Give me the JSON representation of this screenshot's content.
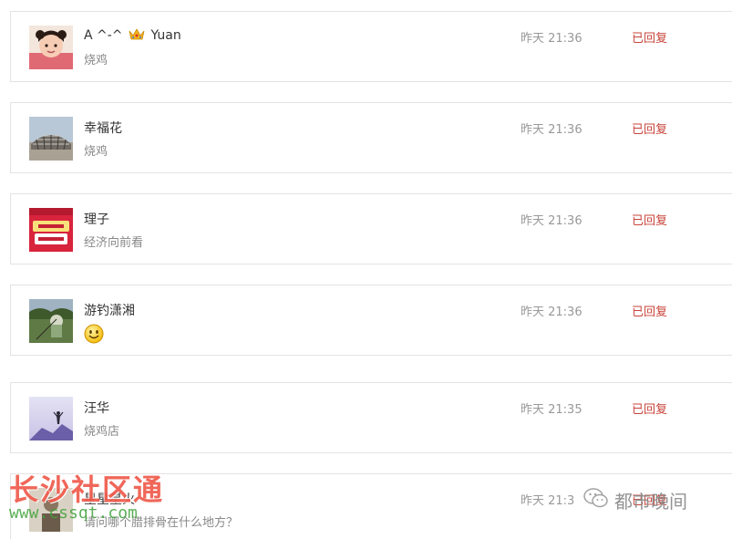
{
  "comments": [
    {
      "name": "A ^-^",
      "name_suffix": "Yuan",
      "has_crown": true,
      "message": "烧鸡",
      "time": "昨天 21:36",
      "status": "已回复"
    },
    {
      "name": "幸福花",
      "message": "烧鸡",
      "time": "昨天 21:36",
      "status": "已回复"
    },
    {
      "name": "理子",
      "message": "经济向前看",
      "time": "昨天 21:36",
      "status": "已回复"
    },
    {
      "name": "游钓潇湘",
      "message": "",
      "message_icon": "smiley-emoji-icon",
      "time": "昨天 21:36",
      "status": "已回复"
    },
    {
      "name": "汪华",
      "message": "烧鸡店",
      "time": "昨天 21:35",
      "status": "已回复"
    },
    {
      "name": "星星星火",
      "message": "请问哪个腊排骨在什么地方？",
      "time": "昨天 21:3",
      "status": "已回复"
    }
  ],
  "watermark": {
    "text": "长沙社区通",
    "url": "www.cssqt.com",
    "brand": "都市晚间",
    "brand_icon": "wechat-icon"
  },
  "colors": {
    "status": "#c8443a",
    "watermark": "#ef5b4c",
    "watermark_url": "#3fa23a"
  }
}
